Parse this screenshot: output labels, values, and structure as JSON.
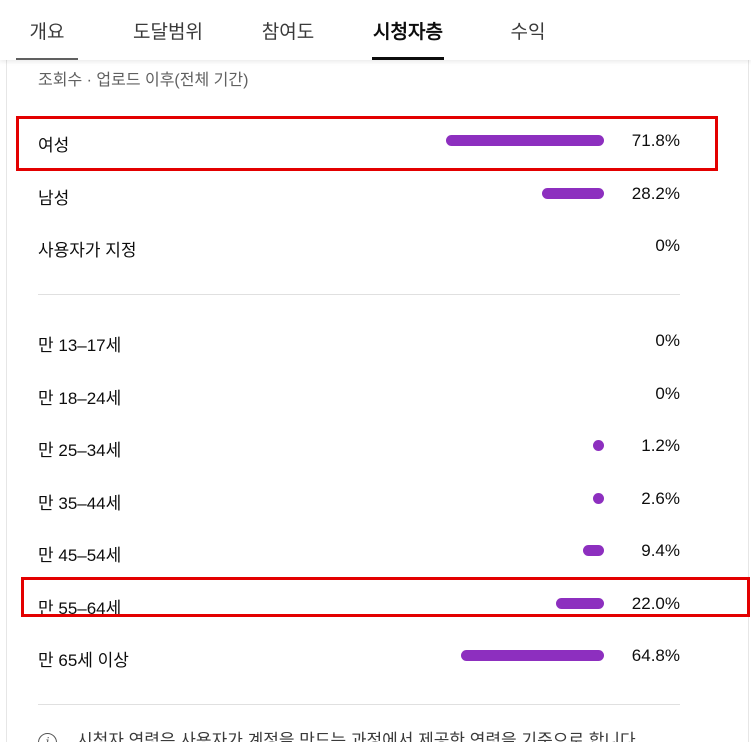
{
  "tabs": [
    {
      "label": "개요"
    },
    {
      "label": "도달범위"
    },
    {
      "label": "참여도"
    },
    {
      "label": "시청자층"
    },
    {
      "label": "수익"
    }
  ],
  "subtitle": "조회수 · 업로드 이후(전체 기간)",
  "gender": [
    {
      "label": "여성",
      "value": "71.8%",
      "share": 0.718
    },
    {
      "label": "남성",
      "value": "28.2%",
      "share": 0.282
    },
    {
      "label": "사용자가 지정",
      "value": "0%",
      "share": 0
    }
  ],
  "age": [
    {
      "label": "만 13–17세",
      "value": "0%",
      "share": 0
    },
    {
      "label": "만 18–24세",
      "value": "0%",
      "share": 0
    },
    {
      "label": "만 25–34세",
      "value": "1.2%",
      "share": 0.012
    },
    {
      "label": "만 35–44세",
      "value": "2.6%",
      "share": 0.026
    },
    {
      "label": "만 45–54세",
      "value": "9.4%",
      "share": 0.094
    },
    {
      "label": "만 55–64세",
      "value": "22.0%",
      "share": 0.22
    },
    {
      "label": "만 65세 이상",
      "value": "64.8%",
      "share": 0.648
    }
  ],
  "footnote": "시청자 연령은 사용자가 계정을 만드는 과정에서 제공한 연령을 기준으로 합니다.",
  "colors": {
    "bar": "#8d2fbf",
    "highlight": "#e30000"
  }
}
